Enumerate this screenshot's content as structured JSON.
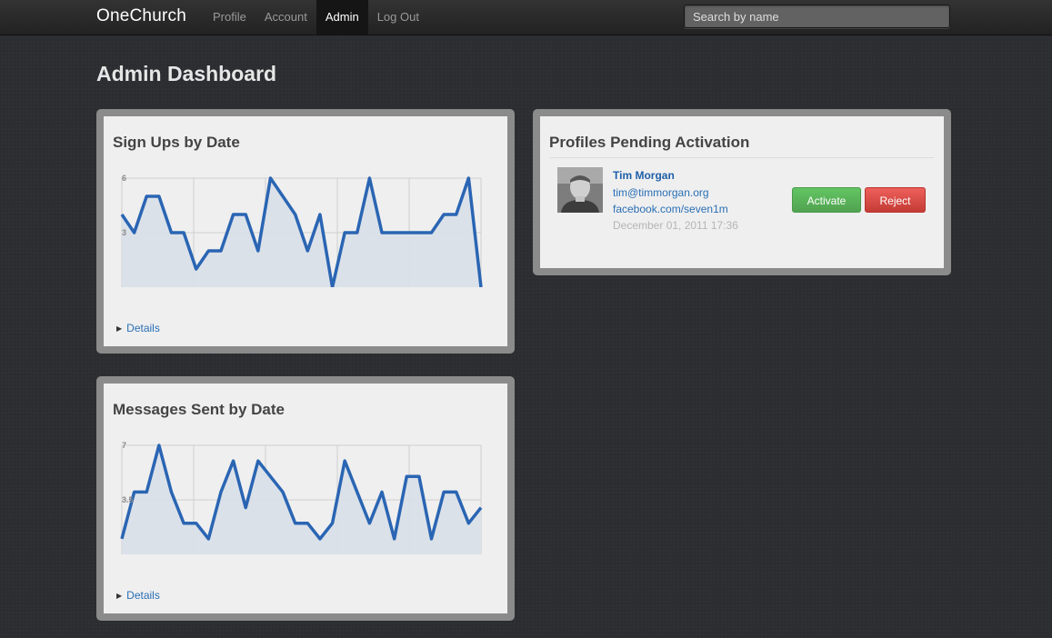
{
  "header": {
    "brand": "OneChurch",
    "nav": [
      {
        "label": "Profile",
        "active": false
      },
      {
        "label": "Account",
        "active": false
      },
      {
        "label": "Admin",
        "active": true
      },
      {
        "label": "Log Out",
        "active": false
      }
    ],
    "search_placeholder": "Search by name"
  },
  "page_title": "Admin Dashboard",
  "signups": {
    "title": "Sign Ups by Date",
    "details_label": "Details"
  },
  "messages": {
    "title": "Messages Sent by Date",
    "details_label": "Details"
  },
  "pending": {
    "title": "Profiles Pending Activation",
    "profile": {
      "name": "Tim Morgan",
      "email": "tim@timmorgan.org",
      "facebook": "facebook.com/seven1m",
      "date": "December 01, 2011 17:36"
    },
    "activate_label": "Activate",
    "reject_label": "Reject"
  },
  "colors": {
    "line": "#2a65b3",
    "fill": "#d8dfe8",
    "activate": "#5bb75b",
    "reject": "#da4f49"
  },
  "chart_data": [
    {
      "type": "area",
      "yticks": [
        3,
        6
      ],
      "ylim": [
        0,
        6
      ],
      "values": [
        4,
        3,
        5,
        5,
        3,
        3,
        1,
        2,
        2,
        4,
        4,
        2,
        6,
        5,
        4,
        2,
        4,
        0,
        3,
        3,
        6,
        3,
        3,
        3,
        3,
        3,
        4,
        4,
        6,
        0
      ]
    },
    {
      "type": "area",
      "yticks": [
        3.5,
        7
      ],
      "ylim": [
        0,
        7
      ],
      "values": [
        1,
        4,
        4,
        7,
        4,
        2,
        2,
        1,
        4,
        6,
        3,
        6,
        5,
        4,
        2,
        2,
        1,
        2,
        6,
        4,
        2,
        4,
        1,
        5,
        5,
        1,
        4,
        4,
        2,
        3
      ]
    }
  ]
}
